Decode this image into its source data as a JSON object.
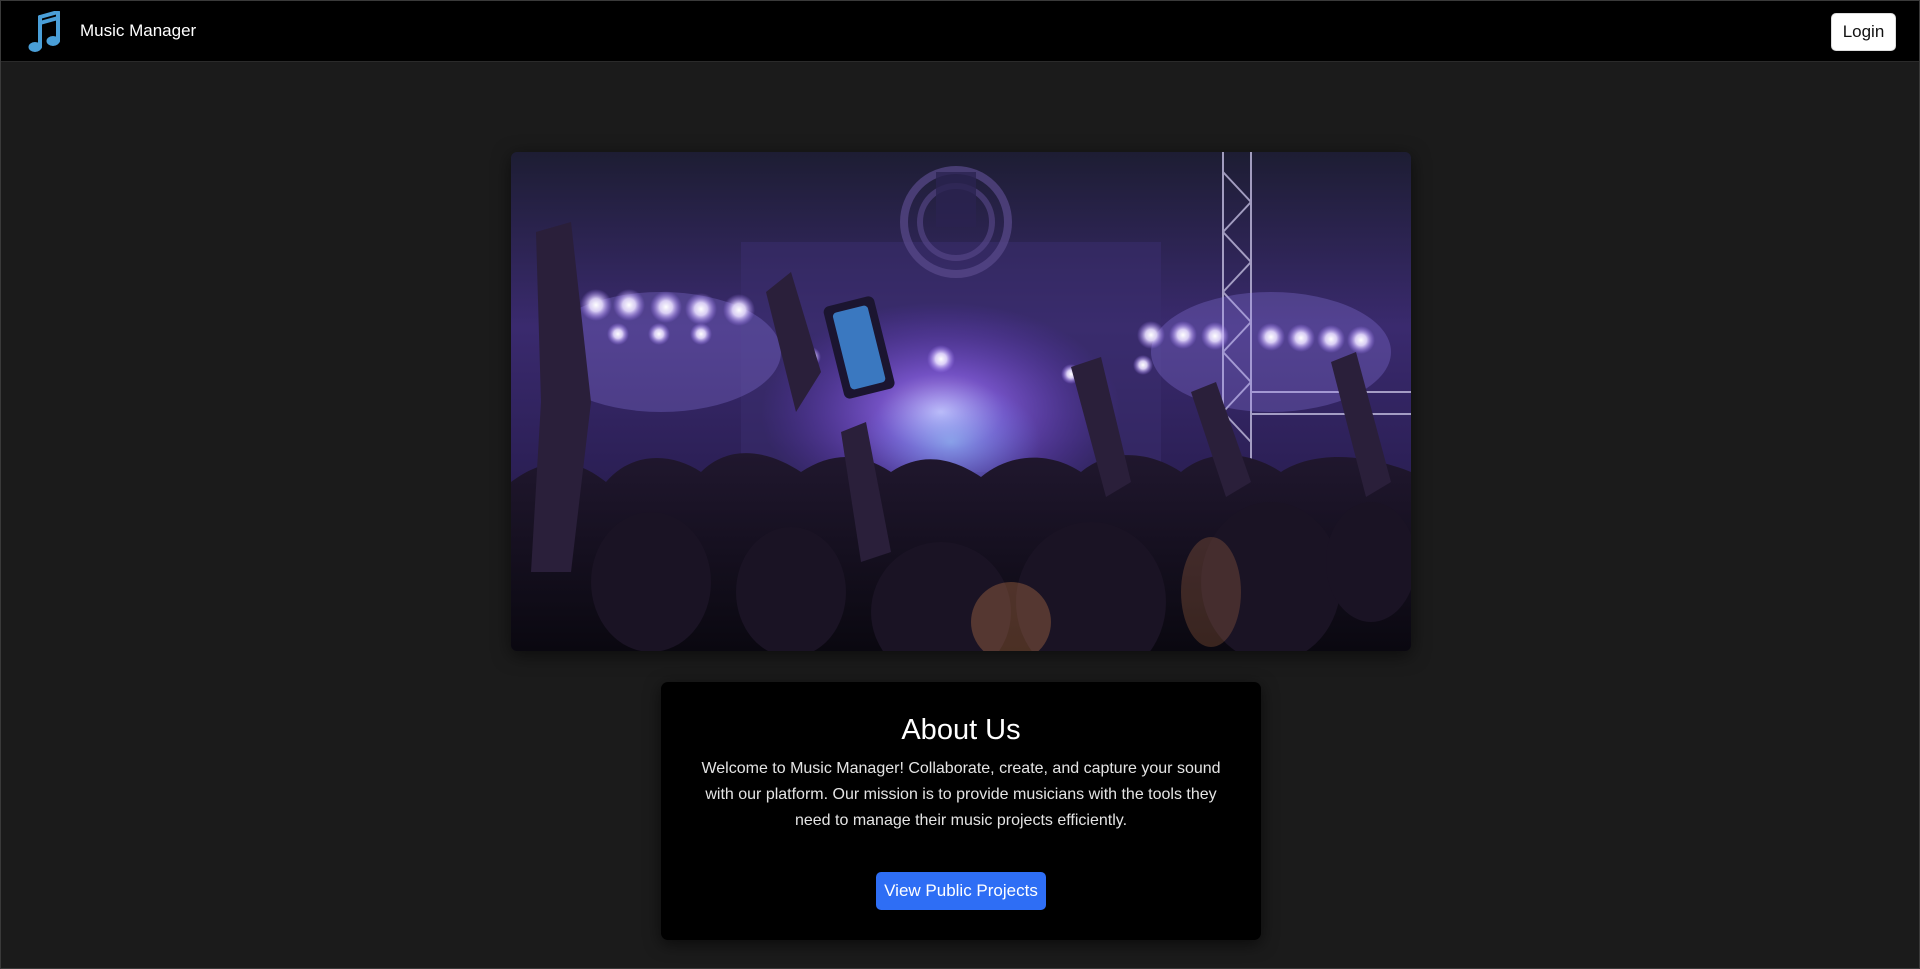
{
  "navbar": {
    "brand_icon": "music-note-icon",
    "brand_icon_color": "#4a9fd8",
    "title": "Music Manager",
    "login_label": "Login"
  },
  "hero": {
    "image": "concert-crowd-photo",
    "accent_color": "#8a4dff"
  },
  "about": {
    "heading": "About Us",
    "body": "Welcome to Music Manager! Collaborate, create, and capture your sound with our platform. Our mission is to provide musicians with the tools they need to manage their music projects efficiently.",
    "button_label": "View Public Projects",
    "button_color": "#2e6ef5"
  }
}
